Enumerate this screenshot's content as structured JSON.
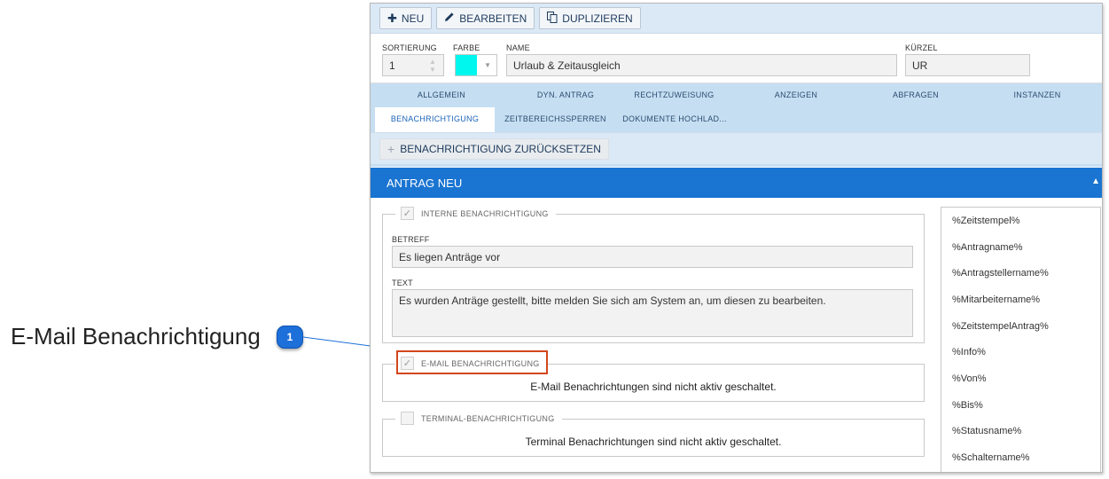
{
  "callout": {
    "label": "E-Mail Benachrichtigung",
    "badge": "1"
  },
  "toolbar": {
    "new_label": "NEU",
    "edit_label": "BEARBEITEN",
    "duplicate_label": "DUPLIZIEREN"
  },
  "fields": {
    "sort_label": "SORTIERUNG",
    "sort_value": "1",
    "color_label": "FARBE",
    "color_value": "#00f7ee",
    "name_label": "NAME",
    "name_value": "Urlaub & Zeitausgleich",
    "short_label": "KÜRZEL",
    "short_value": "UR"
  },
  "tabs": [
    {
      "label": "ALLGEMEIN"
    },
    {
      "label": "DYN. ANTRAG"
    },
    {
      "label": "RECHTZUWEISUNG"
    },
    {
      "label": "ANZEIGEN"
    },
    {
      "label": "ABFRAGEN"
    },
    {
      "label": "INSTANZEN"
    },
    {
      "label": "BENACHRICHTIGUNG"
    },
    {
      "label": "ZEITBEREICHSSPERREN"
    },
    {
      "label": "DOKUMENTE HOCHLAD..."
    }
  ],
  "reset_button": "BENACHRICHTIGUNG ZURÜCKSETZEN",
  "section_title": "ANTRAG NEU",
  "internal": {
    "legend": "INTERNE BENACHRICHTIGUNG",
    "checked": true,
    "subject_label": "BETREFF",
    "subject_value": "Es liegen Anträge vor",
    "text_label": "TEXT",
    "text_value": "Es wurden Anträge gestellt, bitte melden Sie sich am System an, um diesen zu bearbeiten."
  },
  "email": {
    "legend": "E-MAIL BENACHRICHTIGUNG",
    "checked": true,
    "message": "E-Mail Benachrichtungen sind nicht aktiv geschaltet."
  },
  "terminal": {
    "legend": "TERMINAL-BENACHRICHTIGUNG",
    "checked": false,
    "message": "Terminal Benachrichtungen sind nicht aktiv geschaltet."
  },
  "placeholders": [
    "%Zeitstempel%",
    "%Antragname%",
    "%Antragstellername%",
    "%Mitarbeitername%",
    "%ZeitstempelAntrag%",
    "%Info%",
    "%Von%",
    "%Bis%",
    "%Statusname%",
    "%Schaltername%"
  ],
  "colors": {
    "accent": "#1a74d1",
    "highlight": "#d3461c",
    "tabbar": "#c6def2"
  }
}
